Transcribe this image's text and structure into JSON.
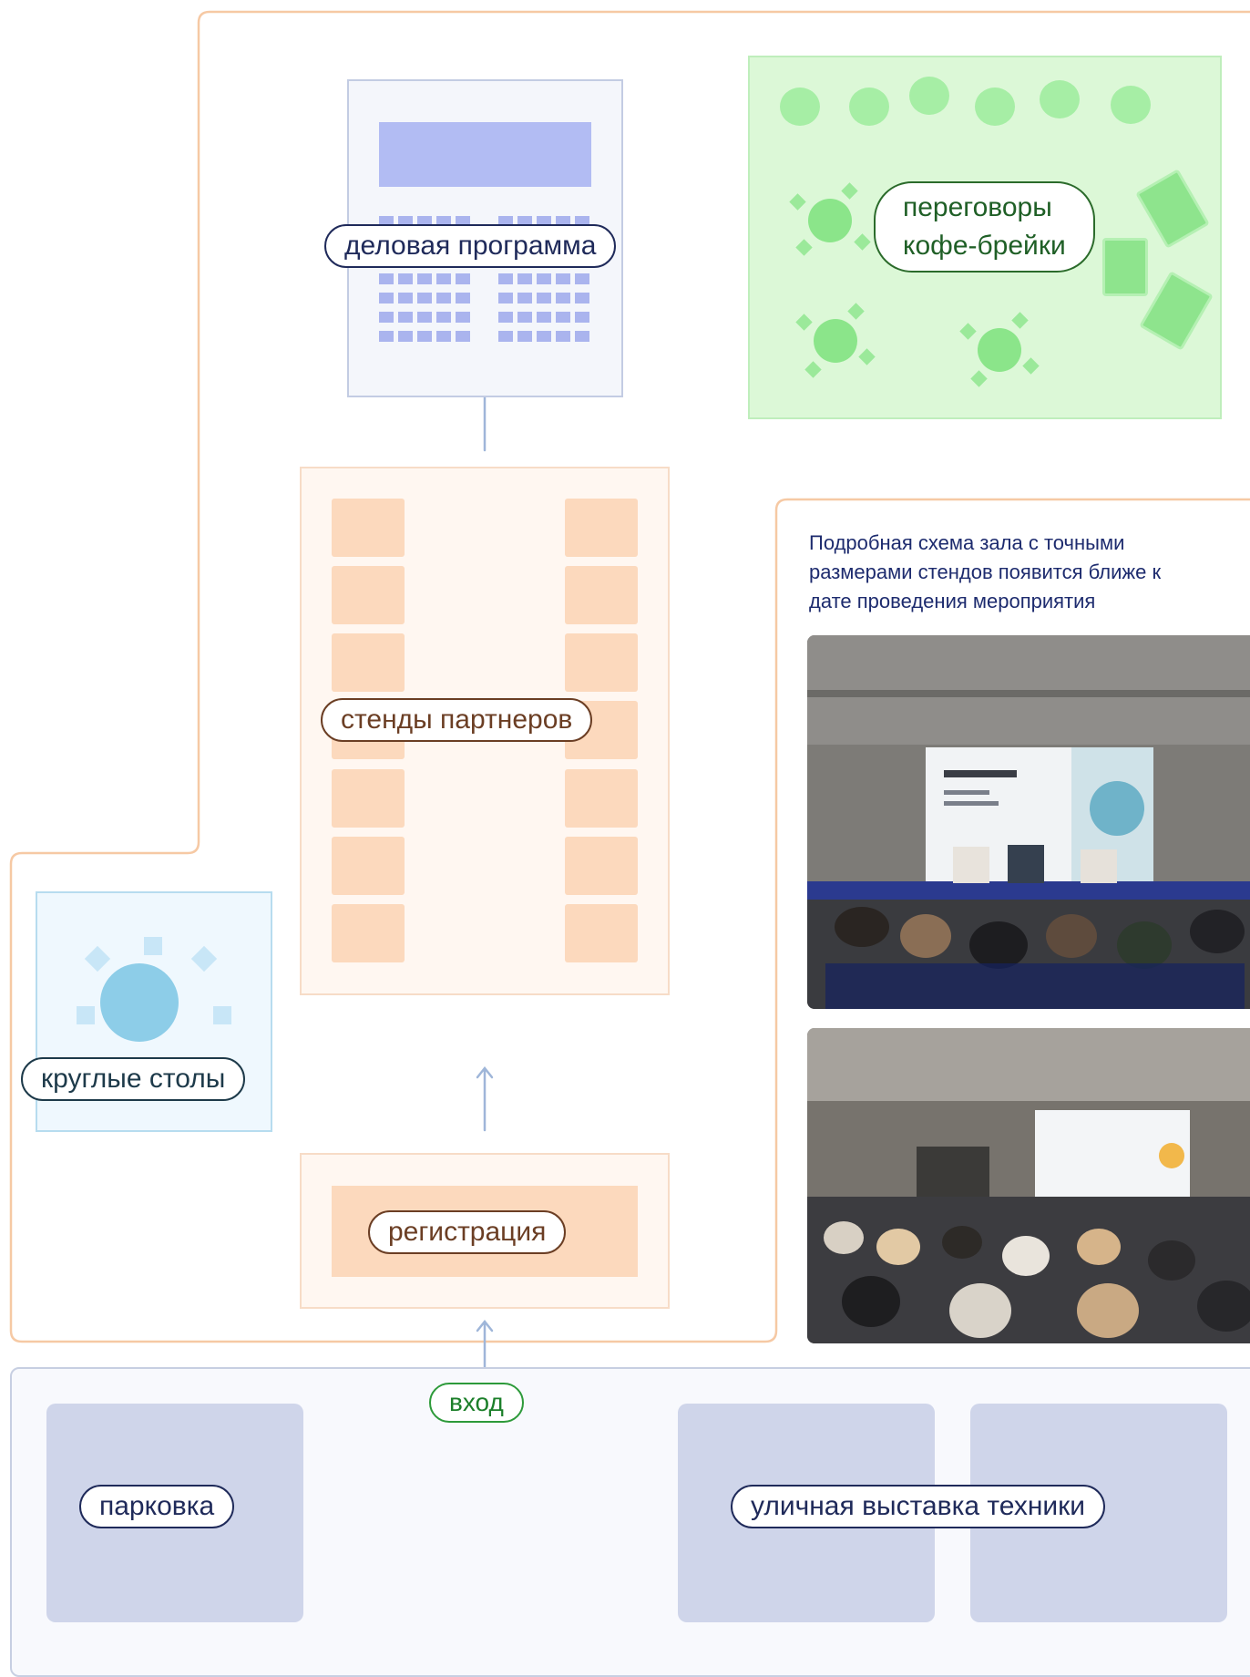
{
  "zones": {
    "business_program": "деловая программа",
    "negotiations_coffee": [
      "переговоры",
      "кофе-брейки"
    ],
    "partner_stands": "стенды партнеров",
    "round_tables": "круглые столы",
    "registration": "регистрация",
    "entrance": "вход",
    "parking": "парковка",
    "outdoor_exhibition": "уличная выставка техники"
  },
  "info": {
    "line1": "Подробная схема зала с точными",
    "line2": "размерами стендов появится ближе к",
    "line3": "дате проведения мероприятия"
  },
  "colors": {
    "hall_outline": "#f6c9a4",
    "arrow": "#9fb6d9",
    "stand": "#fcd9bd",
    "green_zone": "#dcf8d7",
    "blue_zone": "#eff8fe",
    "outdoor_block": "#cfd5ea",
    "text_navy": "#1f2a5a"
  },
  "icons": {
    "arrow": "arrow-up-icon",
    "table": "round-table-icon",
    "sofa": "sofa-icon"
  }
}
